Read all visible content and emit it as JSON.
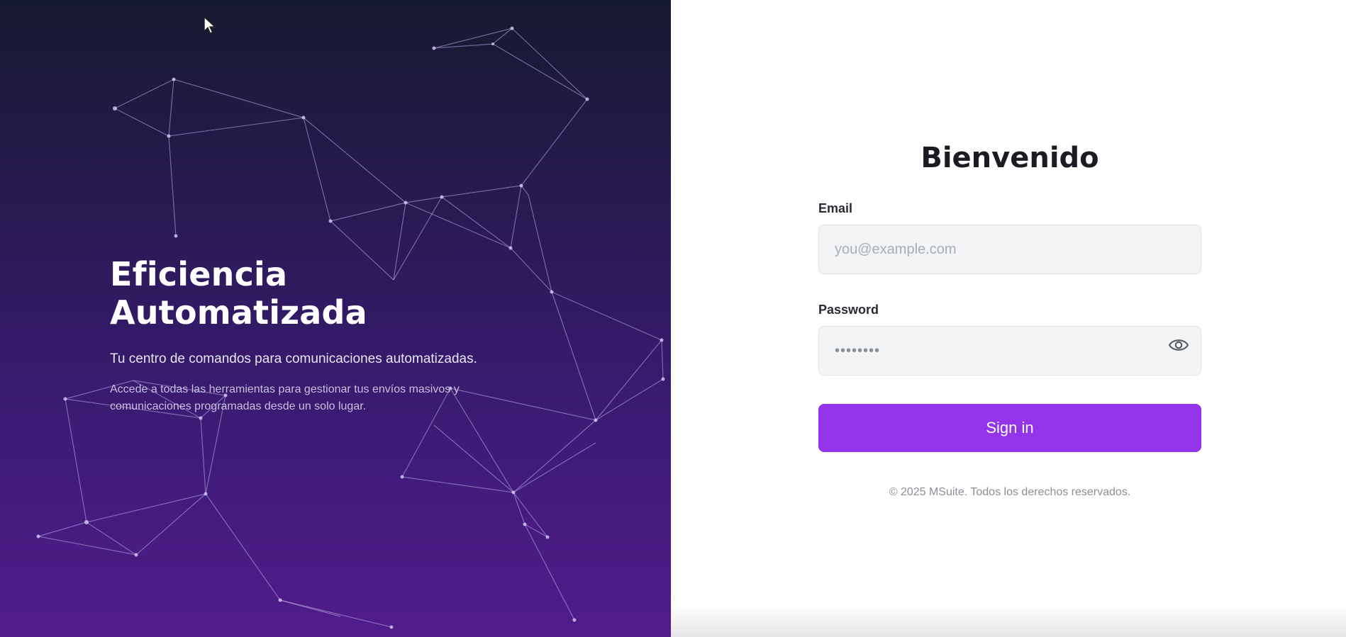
{
  "hero": {
    "title": "Eficiencia Automatizada",
    "subtitle": "Tu centro de comandos para comunicaciones automatizadas.",
    "description": "Accede a todas las herramientas para gestionar tus envíos masivos y comunicaciones programadas desde un solo lugar."
  },
  "login": {
    "title": "Bienvenido",
    "email_label": "Email",
    "email_placeholder": "you@example.com",
    "password_label": "Password",
    "password_value": "••••••••",
    "signin_label": "Sign in",
    "footer": "© 2025 MSuite. Todos los derechos reservados."
  },
  "icons": {
    "password_toggle": "eye-icon",
    "cursor": "mouse-pointer-icon"
  },
  "colors": {
    "accent": "#9333ea",
    "hero_top": "#161a30",
    "hero_bottom": "#511c8a"
  }
}
